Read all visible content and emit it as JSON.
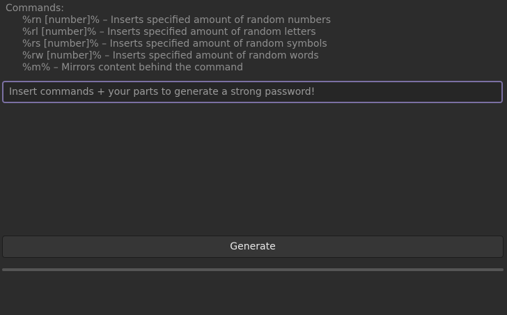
{
  "help": {
    "title": "Commands:",
    "commands": [
      "%rn [number]%  –  Inserts specified amount of random numbers",
      "%rl [number]%  –  Inserts specified amount of random letters",
      "%rs [number]%  –  Inserts specified amount of random symbols",
      "%rw [number]%  –  Inserts specified amount of random words",
      "%m%  –  Mirrors content behind the command"
    ]
  },
  "input": {
    "value": "",
    "placeholder": "Insert commands + your parts to generate a strong password!"
  },
  "generate": {
    "label": "Generate"
  },
  "progress": {
    "value": 0
  },
  "colors": {
    "background": "#2c2c2c",
    "accent": "#7b70a3",
    "text_muted": "#8f8f8f"
  }
}
